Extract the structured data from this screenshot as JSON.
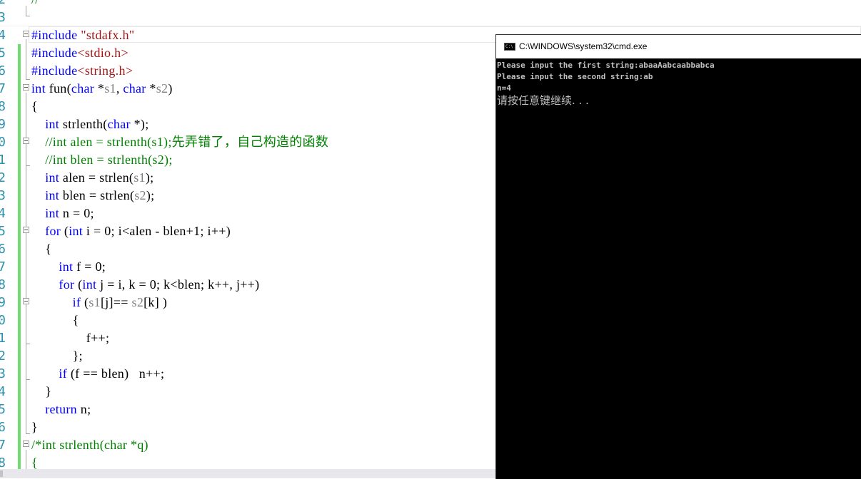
{
  "editor": {
    "lines": [
      {
        "n": "2",
        "html": "<span class='cm'>//</span>"
      },
      {
        "n": "3",
        "html": ""
      },
      {
        "n": "4",
        "html": "<span class='pp'>#include</span> <span class='str'>\"stdafx.h\"</span>"
      },
      {
        "n": "5",
        "html": "<span class='pp'>#include</span><span class='str'>&lt;stdio.h&gt;</span>"
      },
      {
        "n": "6",
        "html": "<span class='pp'>#include</span><span class='str'>&lt;string.h&gt;</span>"
      },
      {
        "n": "7",
        "html": "<span class='kw'>int</span> fun(<span class='kw'>char</span> *<span class='param'>s1</span>, <span class='kw'>char</span> *<span class='param'>s2</span>)"
      },
      {
        "n": "8",
        "html": "{"
      },
      {
        "n": "9",
        "html": "    <span class='kw'>int</span> strlenth(<span class='kw'>char</span> *);"
      },
      {
        "n": "0",
        "html": "    <span class='cm'>//int alen = strlenth(s1);先弄错了，自己构造的函数</span>"
      },
      {
        "n": "1",
        "html": "    <span class='cm'>//int blen = strlenth(s2);</span>"
      },
      {
        "n": "2",
        "html": "    <span class='kw'>int</span> alen = strlen(<span class='param'>s1</span>);"
      },
      {
        "n": "3",
        "html": "    <span class='kw'>int</span> blen = strlen(<span class='param'>s2</span>);"
      },
      {
        "n": "4",
        "html": "    <span class='kw'>int</span> n = 0;"
      },
      {
        "n": "5",
        "html": "    <span class='kw'>for</span> (<span class='kw'>int</span> i = 0; i&lt;alen - blen+1; i++)"
      },
      {
        "n": "6",
        "html": "    {"
      },
      {
        "n": "7",
        "html": "        <span class='kw'>int</span> f = 0;"
      },
      {
        "n": "8",
        "html": "        <span class='kw'>for</span> (<span class='kw'>int</span> j = i, k = 0; k&lt;blen; k++, j++)"
      },
      {
        "n": "9",
        "html": "            <span class='kw'>if</span> (<span class='param'>s1</span>[j]== <span class='param'>s2</span>[k] )"
      },
      {
        "n": "0",
        "html": "            {"
      },
      {
        "n": "1",
        "html": "                f++;"
      },
      {
        "n": "2",
        "html": "            };"
      },
      {
        "n": "3",
        "html": "        <span class='kw'>if</span> (f == blen)   n++;"
      },
      {
        "n": "4",
        "html": "    }"
      },
      {
        "n": "5",
        "html": "    <span class='kw'>return</span> n;"
      },
      {
        "n": "6",
        "html": "}"
      },
      {
        "n": "7",
        "html": "<span class='cm'>/*int strlenth(char *q)</span>"
      },
      {
        "n": "8",
        "html": "<span class='cm'>{</span>"
      }
    ]
  },
  "console": {
    "title": "C:\\WINDOWS\\system32\\cmd.exe",
    "icon": "C:\\",
    "output": [
      "Please input the first string:abaaAabcaabbabca",
      "Please input the second string:ab",
      "n=4",
      "请按任意键继续. . ."
    ]
  }
}
